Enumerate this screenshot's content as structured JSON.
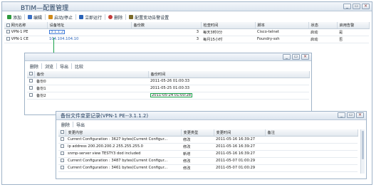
{
  "main": {
    "title": "BTIM—配置管理",
    "toolbar": [
      {
        "label": "添加",
        "icon": "add-icon",
        "color": "#2e9a3e"
      },
      {
        "label": "编辑",
        "icon": "edit-icon",
        "color": "#3a6fc4"
      },
      {
        "label": "启动/停止",
        "icon": "play-stop-icon",
        "color": "#d08a1a"
      },
      {
        "label": "立即运行",
        "icon": "run-now-icon",
        "color": "#2a63b8"
      },
      {
        "label": "删除",
        "icon": "delete-icon",
        "color": "#c43a3a"
      },
      {
        "label": "配置变动告警设置",
        "icon": "alarm-settings-icon",
        "color": "#7a6a2a"
      }
    ],
    "columns": [
      "网元名称",
      "设备地址",
      "备份数",
      "检查时间",
      "脚本",
      "状态",
      "启用告警"
    ],
    "rows": [
      {
        "name": "VPN-1 PE",
        "address": "3.1.1.2",
        "backups": "3",
        "check_time": "每天3时0分",
        "script": "Cisco-telnet",
        "status": "启动",
        "alarm": "是"
      },
      {
        "name": "VPN-1 CE",
        "address": "104.104.104.10",
        "backups": "3",
        "check_time": "每月15小时",
        "script": "Foundry-ssh",
        "status": "启动",
        "alarm": "否"
      }
    ]
  },
  "backup": {
    "toolbar": [
      "删除",
      "浏览",
      "导出",
      "比较"
    ],
    "columns": [
      "备份",
      "备份时间"
    ],
    "rows": [
      {
        "name": "备份0",
        "time": "2011-05-26 01:00:33"
      },
      {
        "name": "备份1",
        "time": "2011-05-25 01:00:33"
      },
      {
        "name": "备份2",
        "time": "2011-05-24 01:00:28"
      }
    ]
  },
  "changes": {
    "title": "备份文件变更记录(VPN-1 PE--3.1.1.2)",
    "toolbar": [
      "删除",
      "导出"
    ],
    "columns": [
      "变更内容",
      "变更类型",
      "变更时间",
      "备注"
    ],
    "rows": [
      {
        "content": "Current Configuration : 3627 bytes(Current Configur...",
        "type": "修改",
        "time": "2011-05-16 16:39:27",
        "note": ""
      },
      {
        "content": "ip address 200.200.200.2 255.255.255.0",
        "type": "修改",
        "time": "2011-05-16 16:39:27",
        "note": ""
      },
      {
        "content": "snmp-server view TESTY3 dod included",
        "type": "新增",
        "time": "2011-05-16 16:39:27",
        "note": ""
      },
      {
        "content": "Current Configuration : 3487 bytes(Current Configur...",
        "type": "修改",
        "time": "2011-05-07 01:00:29",
        "note": ""
      },
      {
        "content": "Current Configuration : 3461 bytes(Current Configur...",
        "type": "修改",
        "time": "2011-05-07 01:00:29",
        "note": ""
      }
    ]
  },
  "window_controls": [
    "minimize-icon",
    "maximize-icon",
    "close-icon"
  ],
  "accent": "#19a24a"
}
